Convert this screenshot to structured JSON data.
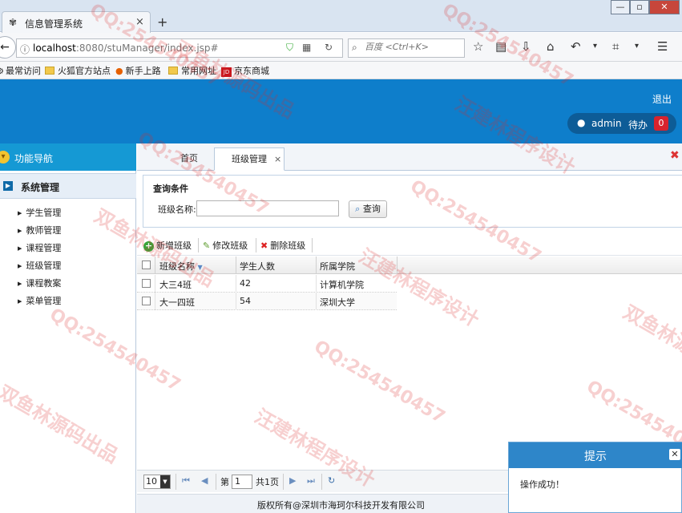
{
  "browser": {
    "tab_title": "信息管理系统",
    "new_tab_symbol": "+",
    "url_host": "localhost",
    "url_rest": ":8080/stuManager/index.jsp#",
    "search_placeholder": "百度 <Ctrl+K>",
    "bookmarks": [
      "最常访问",
      "火狐官方站点",
      "新手上路",
      "常用网址",
      "京东商城"
    ]
  },
  "header": {
    "logout": "退出",
    "username": "admin",
    "todo_label": "待办",
    "todo_count": "0"
  },
  "nav": {
    "title": "功能导航",
    "section": "系统管理",
    "items": [
      "学生管理",
      "教师管理",
      "课程管理",
      "班级管理",
      "课程教案",
      "菜单管理"
    ]
  },
  "tabs": {
    "home": "首页",
    "current": "班级管理",
    "close": "×"
  },
  "query": {
    "title": "查询条件",
    "class_label": "班级名称:",
    "class_value": "",
    "button": "查询"
  },
  "toolbar": {
    "add": "新增班级",
    "edit": "修改班级",
    "delete": "删除班级"
  },
  "table": {
    "columns": [
      "班级名称",
      "学生人数",
      "所属学院"
    ],
    "rows": [
      {
        "name": "大三4班",
        "count": "42",
        "college": "计算机学院"
      },
      {
        "name": "大一四班",
        "count": "54",
        "college": "深圳大学"
      }
    ]
  },
  "pager": {
    "page_size": "10",
    "page_prefix": "第",
    "page_value": "1",
    "page_suffix": "共1页"
  },
  "footer": {
    "copyright": "版权所有@深圳市海珂尔科技开发有限公司"
  },
  "toast": {
    "title": "提示",
    "message": "操作成功！"
  },
  "watermarks": [
    "QQ:254540457",
    "双鱼林源码出品",
    "汪建林程序设计"
  ],
  "colors": {
    "header_blue": "#0e7ecb",
    "nav_blue": "#1599d4",
    "toast_blue": "#2e86c9",
    "badge_red": "#d9232d"
  }
}
